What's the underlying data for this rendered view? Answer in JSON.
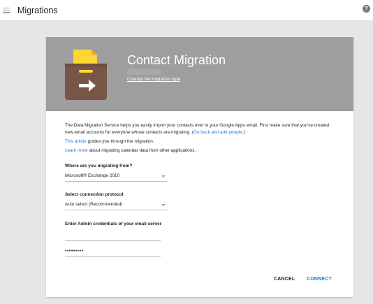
{
  "topbar": {
    "title": "Migrations",
    "help_symbol": "?"
  },
  "card": {
    "title": "Contact Migration",
    "change_link": "Change the migration type",
    "description": {
      "line1_text": "The Data Migration Service helps you easily import your contacts over to your Google Apps email. First make sure that you've created new email accounts for everyone whose contacts are migrating.",
      "line1_link": "Go back and add people.",
      "article_link": "This article",
      "article_text": " guides you through the migration.",
      "learn_link": "Learn more",
      "learn_text": " about migrating calendar data from other applications."
    },
    "migrate_from": {
      "label": "Where are you migrating from?",
      "value": "Microsoft® Exchange 2010"
    },
    "protocol": {
      "label": "Select connection protocol",
      "value": "Auto select (Recommended)"
    },
    "credentials": {
      "label": "Enter Admin credentials of your email server",
      "username": "",
      "password": "•••••••••"
    },
    "buttons": {
      "cancel": "CANCEL",
      "connect": "CONNECT"
    }
  },
  "colors": {
    "header_bg": "#9e9e9e",
    "accent": "#1a73e8",
    "folder_yellow": "#fdd835",
    "box_brown": "#795548"
  }
}
